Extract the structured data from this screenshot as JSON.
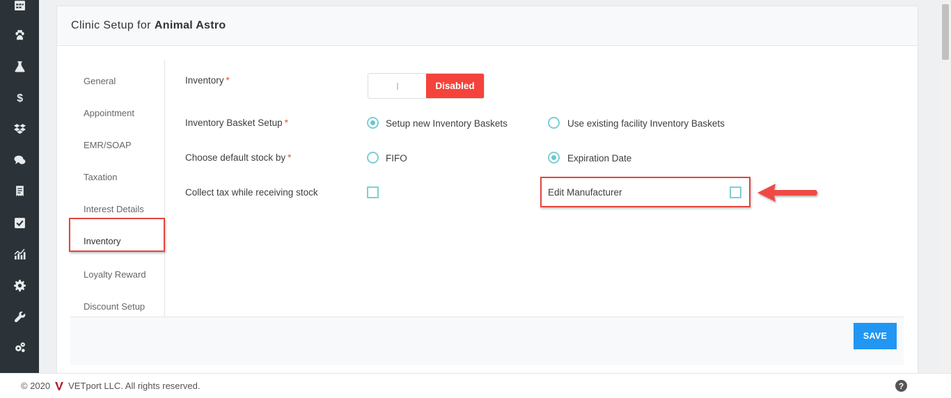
{
  "rail": {
    "icons": [
      "calendar-icon",
      "paw-icon",
      "flask-icon",
      "dollar-icon",
      "dropbox-icon",
      "chat-icon",
      "receipt-icon",
      "checkbox-icon",
      "chart-icon",
      "gear-icon",
      "wrench-icon",
      "gears-icon"
    ]
  },
  "header": {
    "prefix": "Clinic Setup for",
    "clinic_name": "Animal Astro"
  },
  "nav": {
    "items": [
      {
        "label": "General"
      },
      {
        "label": "Appointment"
      },
      {
        "label": "EMR/SOAP"
      },
      {
        "label": "Taxation"
      },
      {
        "label": "Interest Details"
      },
      {
        "label": "Inventory"
      },
      {
        "label": "Loyalty Reward"
      },
      {
        "label": "Discount Setup"
      }
    ],
    "active": "Inventory"
  },
  "form": {
    "inventory": {
      "label": "Inventory",
      "required_mark": "*",
      "toggle_state": "Disabled"
    },
    "basket": {
      "label": "Inventory Basket Setup",
      "required_mark": "*",
      "options": [
        "Setup new Inventory Baskets",
        "Use existing facility Inventory Baskets"
      ],
      "selected": "Setup new Inventory Baskets"
    },
    "stock": {
      "label": "Choose default stock by",
      "required_mark": "*",
      "options": [
        "FIFO",
        "Expiration Date"
      ],
      "selected": "Expiration Date"
    },
    "collect_tax": {
      "label": "Collect tax while receiving stock",
      "checked": false
    },
    "edit_manufacturer": {
      "label": "Edit Manufacturer",
      "checked": false
    }
  },
  "actions": {
    "save_label": "SAVE"
  },
  "colors": {
    "accent": "#2196f3",
    "disabled": "#f4433b",
    "highlight": "#e2463f",
    "control": "#7ccfd4"
  },
  "footer": {
    "copyright": "© 2020",
    "company": "VETport LLC. All rights reserved.",
    "help_icon": "?"
  }
}
